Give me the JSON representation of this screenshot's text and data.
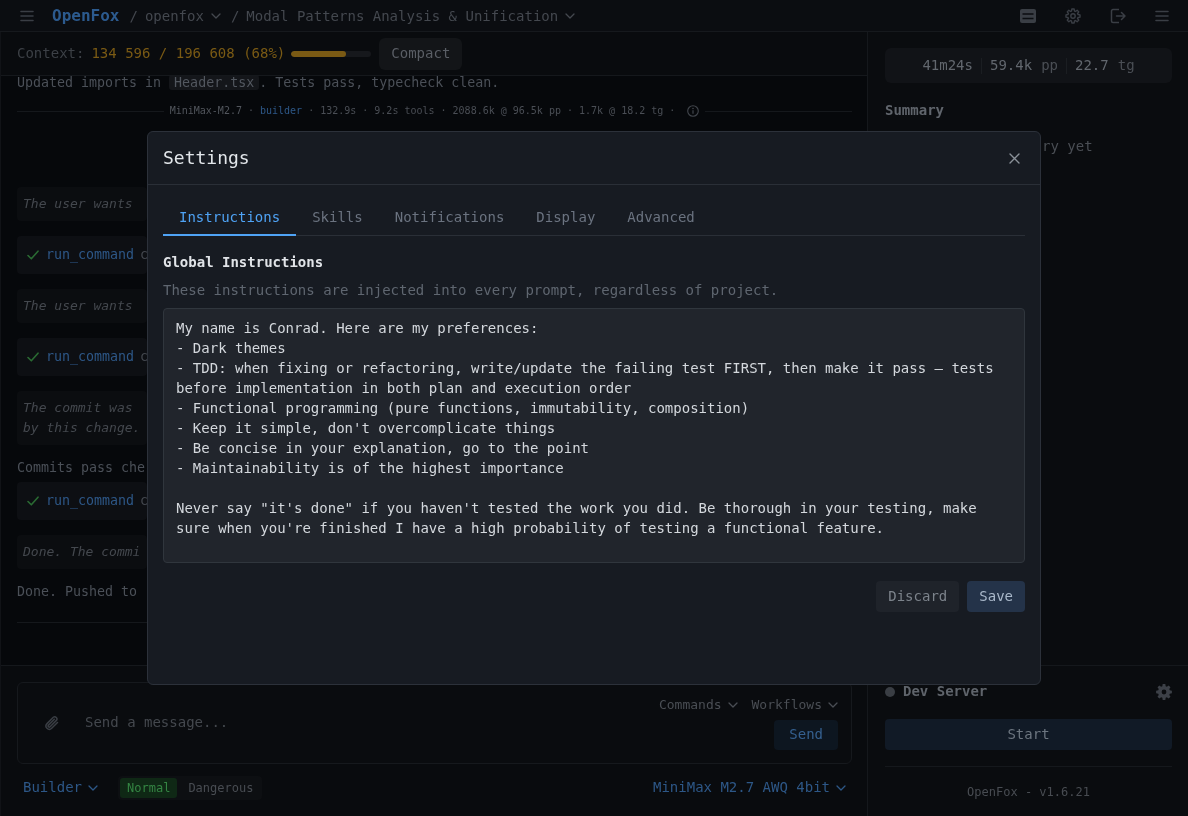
{
  "top_bar": {
    "breadcrumbs": [
      {
        "kind": "brand",
        "text": "OpenFox"
      },
      {
        "kind": "separator",
        "text": "/"
      },
      {
        "kind": "dropdown",
        "text": "openfox"
      },
      {
        "kind": "separator",
        "text": "/"
      },
      {
        "kind": "dropdown",
        "text": "Modal Patterns Analysis & Unification"
      }
    ]
  },
  "context_bar": {
    "label": "Context:",
    "reading": "134 596 / 196 608 (68%)",
    "level": 0.68,
    "button": "Compact"
  },
  "chat": {
    "messages": [
      {
        "kind": "text",
        "segments": [
          {
            "kind": "plain",
            "text": "Updated imports in "
          },
          {
            "kind": "code",
            "text": "Header.tsx"
          },
          {
            "kind": "plain",
            "text": ". Tests pass, typecheck clean."
          }
        ]
      },
      {
        "kind": "meta",
        "parts": [
          {
            "kind": "model",
            "text": "MiniMax-M2.7"
          },
          {
            "kind": "separator",
            "text": "·"
          },
          {
            "kind": "agent",
            "text": "builder"
          },
          {
            "kind": "separator",
            "text": "·"
          },
          {
            "kind": "stat",
            "text": "132.9s"
          },
          {
            "kind": "separator",
            "text": "·"
          },
          {
            "kind": "stat",
            "text": "9.2s tools"
          },
          {
            "kind": "separator",
            "text": "·"
          },
          {
            "kind": "stat",
            "text": "2088.6k @ 96.5k pp"
          },
          {
            "kind": "separator",
            "text": "·"
          },
          {
            "kind": "stat",
            "text": "1.7k @ 18.2 tg"
          },
          {
            "kind": "separator",
            "text": "·"
          }
        ]
      },
      {
        "kind": "thinking",
        "text": "The user wants"
      },
      {
        "kind": "tool",
        "succeeded": true,
        "name": "run_command",
        "detail": "c"
      },
      {
        "kind": "thinking",
        "text": "The user wants"
      },
      {
        "kind": "tool",
        "succeeded": true,
        "name": "run_command",
        "detail": "c"
      },
      {
        "kind": "thinking",
        "text": "The commit was\nby this change."
      },
      {
        "kind": "text",
        "segments": [
          {
            "kind": "plain",
            "text": "Commits pass che"
          }
        ]
      },
      {
        "kind": "tool",
        "succeeded": true,
        "name": "run_command",
        "detail": "c"
      },
      {
        "kind": "thinking",
        "text": "Done. The commi"
      },
      {
        "kind": "text",
        "segments": [
          {
            "kind": "plain",
            "text": "Done. Pushed to"
          }
        ]
      }
    ]
  },
  "composer": {
    "placeholder": "Send a message...",
    "menus": [
      "Commands",
      "Workflows"
    ],
    "send_button": "Send"
  },
  "bottom_bar": {
    "agent": "Builder",
    "modes": [
      {
        "label": "Normal",
        "selected": true
      },
      {
        "label": "Dangerous",
        "selected": false
      }
    ],
    "model": "MiniMax M2.7 AWQ 4bit"
  },
  "side_panel": {
    "stats": [
      {
        "value": "41m24s"
      },
      {
        "value": "59.4k",
        "unit": "pp"
      },
      {
        "value": "22.7",
        "unit": "tg"
      }
    ],
    "summary_title": "Summary",
    "summary_text": "ry yet",
    "dev_server": {
      "label": "Dev Server",
      "running": false
    },
    "start_button": "Start",
    "version": "OpenFox - v1.6.21"
  },
  "modal": {
    "title": "Settings",
    "tabs": [
      {
        "label": "Instructions",
        "selected": true
      },
      {
        "label": "Skills",
        "selected": false
      },
      {
        "label": "Notifications",
        "selected": false
      },
      {
        "label": "Display",
        "selected": false
      },
      {
        "label": "Advanced",
        "selected": false
      }
    ],
    "section_title": "Global Instructions",
    "description": "These instructions are injected into every prompt, regardless of project.",
    "instructions": "My name is Conrad. Here are my preferences:\n- Dark themes\n- TDD: when fixing or refactoring, write/update the failing test FIRST, then make it pass — tests before implementation in both plan and execution order\n- Functional programming (pure functions, immutability, composition)\n- Keep it simple, don't overcomplicate things\n- Be concise in your explanation, go to the point\n- Maintainability is of the highest importance\n\nNever say \"it's done\" if you haven't tested the work you did. Be thorough in your testing, make sure when you're finished I have a high probability of testing a functional feature.",
    "buttons": [
      {
        "kind": "secondary",
        "label": "Discard"
      },
      {
        "kind": "primary",
        "label": "Save"
      }
    ]
  }
}
